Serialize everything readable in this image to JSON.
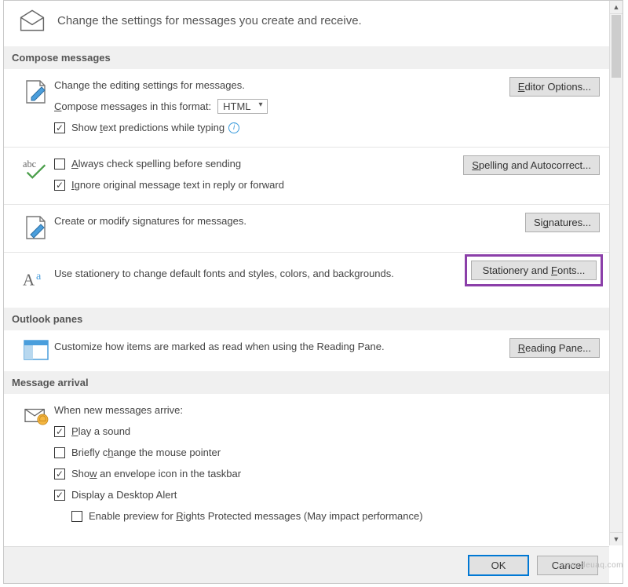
{
  "header": {
    "text": "Change the settings for messages you create and receive."
  },
  "sections": {
    "compose": {
      "title": "Compose messages",
      "editing_desc": "Change the editing settings for messages.",
      "editor_btn": "Editor Options...",
      "format_label_pre": "C",
      "format_label_post": "ompose messages in this format:",
      "format_value": "HTML",
      "predictions_pre": "Show ",
      "predictions_u": "t",
      "predictions_post": "ext predictions while typing",
      "spell_u": "A",
      "spell_post": "lways check spelling before sending",
      "spelling_btn": "Spelling and Autocorrect...",
      "ignore_u": "I",
      "ignore_post": "gnore original message text in reply or forward",
      "signatures_desc": "Create or modify signatures for messages.",
      "signatures_btn": "Signatures...",
      "stationery_desc": "Use stationery to change default fonts and styles, colors, and backgrounds.",
      "stationery_btn_pre": "Stationery and ",
      "stationery_btn_u": "F",
      "stationery_btn_post": "onts..."
    },
    "panes": {
      "title": "Outlook panes",
      "reading_desc": "Customize how items are marked as read when using the Reading Pane.",
      "reading_btn_u": "R",
      "reading_btn_post": "eading Pane..."
    },
    "arrival": {
      "title": "Message arrival",
      "when": "When new messages arrive:",
      "play_u": "P",
      "play_post": "lay a sound",
      "mouse_pre": "Briefly c",
      "mouse_u": "h",
      "mouse_post": "ange the mouse pointer",
      "env_pre": "Sho",
      "env_u": "w",
      "env_post": " an envelope icon in the taskbar",
      "desktop": "Display a Desktop Alert",
      "preview_pre": "Enable preview for ",
      "preview_u": "R",
      "preview_post": "ights Protected messages (May impact performance)"
    }
  },
  "buttons": {
    "ok": "OK",
    "cancel": "Cancel"
  },
  "checked": {
    "predictions": true,
    "spell": false,
    "ignore": true,
    "play": true,
    "mouse": false,
    "env": true,
    "desktop": true,
    "preview": false
  },
  "watermark": "www.deuaq.com"
}
